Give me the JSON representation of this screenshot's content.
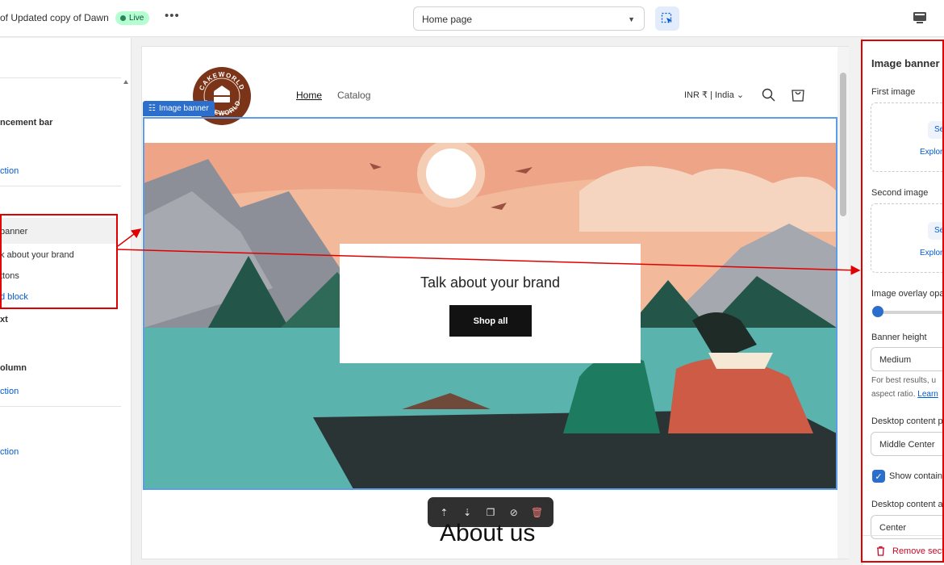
{
  "topbar": {
    "store_title": "of Updated copy of Dawn",
    "live_badge": "Live",
    "more_label": "•••",
    "page_selector": "Home page"
  },
  "left_sidebar": {
    "items": [
      {
        "label": "ncement bar",
        "type": "item"
      },
      {
        "label": "",
        "type": "item"
      },
      {
        "label": "ction",
        "type": "link"
      },
      {
        "label": "banner",
        "type": "item"
      },
      {
        "label": "k about your brand",
        "type": "item"
      },
      {
        "label": "ttons",
        "type": "item"
      },
      {
        "label": "d block",
        "type": "link"
      },
      {
        "label": "xt",
        "type": "item"
      },
      {
        "label": "olumn",
        "type": "item"
      },
      {
        "label": "ction",
        "type": "link"
      },
      {
        "label": "ction",
        "type": "link"
      }
    ]
  },
  "preview": {
    "logo_text": "CAKEWORLD",
    "nav": {
      "home": "Home",
      "catalog": "Catalog"
    },
    "currency": "INR ₹ | India",
    "banner_tag": "Image banner",
    "banner_heading": "Talk about your brand",
    "shop_button": "Shop all",
    "about_heading": "About us"
  },
  "settings_panel": {
    "title": "Image banner",
    "first_image_label": "First image",
    "second_image_label": "Second image",
    "select_label": "Sele",
    "explore_label": "Explore",
    "overlay_label": "Image overlay opa",
    "banner_height_label": "Banner height",
    "banner_height_value": "Medium",
    "hint_line1": "For best results, u",
    "hint_line2": "aspect ratio. ",
    "hint_link": "Learn",
    "desktop_position_label": "Desktop content p",
    "desktop_position_value": "Middle Center",
    "show_container_label": "Show contain",
    "desktop_alignment_label": "Desktop content a",
    "desktop_alignment_value": "Center",
    "remove_label": "Remove sect"
  },
  "colors": {
    "accent_blue": "#2c6ecb",
    "annotation_red": "#e00000",
    "live_green": "#b4fed2"
  }
}
